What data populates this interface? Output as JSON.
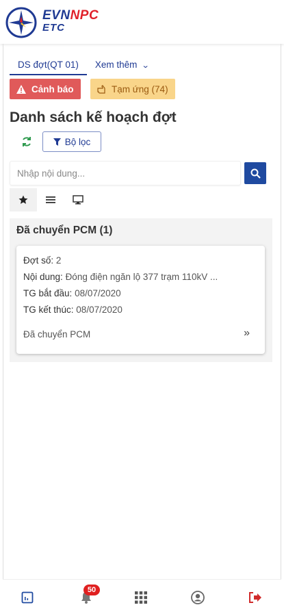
{
  "brand": {
    "evn": "EVN",
    "npc": "NPC",
    "etc": "ETC"
  },
  "tabs": [
    {
      "label": "DS đợt(QT 01)"
    },
    {
      "label": "Xem thêm"
    }
  ],
  "alert_button": {
    "label": "Cảnh báo"
  },
  "advance_button": {
    "label": "Tạm ứng (74)"
  },
  "page_title": "Danh sách kế hoạch đợt",
  "filter_button": {
    "label": "Bộ lọc"
  },
  "search": {
    "placeholder": "Nhập nội dung...",
    "value": ""
  },
  "group": {
    "title": "Đã chuyển PCM (1)",
    "card": {
      "batch_label": "Đợt số:",
      "batch_value": "2",
      "content_label": "Nội dung:",
      "content_value": "Đóng điện ngăn lộ 377 trạm 110kV ...",
      "start_label": "TG bắt đầu:",
      "start_value": "08/07/2020",
      "end_label": "TG kết thúc:",
      "end_value": "08/07/2020",
      "status": "Đã chuyển PCM",
      "arrow": "»"
    }
  },
  "bottom_nav": {
    "notifications_count": "50",
    "icons": [
      "report-icon",
      "bell-icon",
      "apps-grid-icon",
      "user-circle-icon",
      "logout-icon"
    ]
  },
  "colors": {
    "primary": "#1f3a93",
    "danger": "#e05a5a",
    "warning": "#f9d58a",
    "brand_red": "#e0202a"
  }
}
